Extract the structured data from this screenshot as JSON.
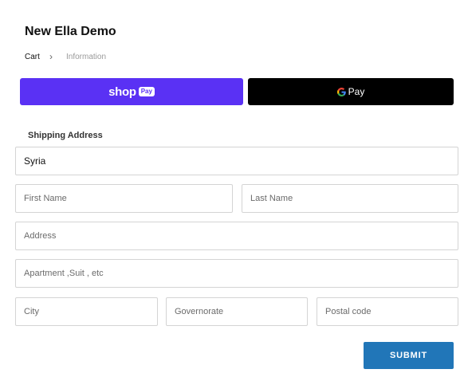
{
  "store": {
    "title": "New Ella Demo"
  },
  "breadcrumb": {
    "cart": "Cart",
    "separator": "›",
    "information": "Information"
  },
  "express": {
    "shop_pay": {
      "word": "shop",
      "pill": "Pay",
      "color": "#5a31f4"
    },
    "google_pay": {
      "word": "Pay",
      "color": "#000000"
    }
  },
  "shipping": {
    "heading": "Shipping Address",
    "country_value": "Syria",
    "first_name_placeholder": "First Name",
    "last_name_placeholder": "Last Name",
    "address_placeholder": "Address",
    "apartment_placeholder": "Apartment ,Suit , etc",
    "city_placeholder": "City",
    "governorate_placeholder": "Governorate",
    "postal_placeholder": "Postal code"
  },
  "submit": {
    "label": "SUBMIT",
    "color": "#2176b8"
  }
}
